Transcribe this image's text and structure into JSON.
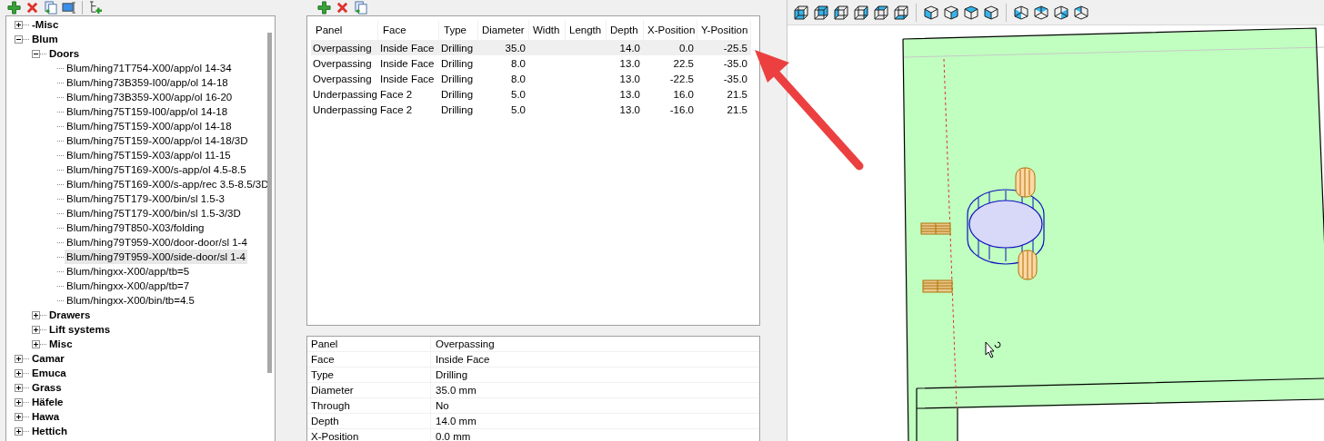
{
  "tree": [
    {
      "label": "-Misc",
      "kind": "folder",
      "expanded": false,
      "selected": false
    },
    {
      "label": "Blum",
      "kind": "folder",
      "expanded": true,
      "selected": false,
      "children": [
        {
          "label": "Doors",
          "kind": "folder",
          "expanded": true,
          "selected": false,
          "children": [
            {
              "label": "Blum/hing71T754-X00/app/ol 14-34",
              "kind": "item",
              "selected": false
            },
            {
              "label": "Blum/hing73B359-I00/app/ol 14-18",
              "kind": "item",
              "selected": false
            },
            {
              "label": "Blum/hing73B359-X00/app/ol 16-20",
              "kind": "item",
              "selected": false
            },
            {
              "label": "Blum/hing75T159-I00/app/ol 14-18",
              "kind": "item",
              "selected": false
            },
            {
              "label": "Blum/hing75T159-X00/app/ol 14-18",
              "kind": "item",
              "selected": false
            },
            {
              "label": "Blum/hing75T159-X00/app/ol 14-18/3D",
              "kind": "item",
              "selected": false
            },
            {
              "label": "Blum/hing75T159-X03/app/ol 11-15",
              "kind": "item",
              "selected": false
            },
            {
              "label": "Blum/hing75T169-X00/s-app/ol 4.5-8.5",
              "kind": "item",
              "selected": false
            },
            {
              "label": "Blum/hing75T169-X00/s-app/rec 3.5-8.5/3D",
              "kind": "item",
              "selected": false
            },
            {
              "label": "Blum/hing75T179-X00/bin/sl 1.5-3",
              "kind": "item",
              "selected": false
            },
            {
              "label": "Blum/hing75T179-X00/bin/sl 1.5-3/3D",
              "kind": "item",
              "selected": false
            },
            {
              "label": "Blum/hing79T850-X03/folding",
              "kind": "item",
              "selected": false
            },
            {
              "label": "Blum/hing79T959-X00/door-door/sl 1-4",
              "kind": "item",
              "selected": false
            },
            {
              "label": "Blum/hing79T959-X00/side-door/sl 1-4",
              "kind": "item",
              "selected": true
            },
            {
              "label": "Blum/hingxx-X00/app/tb=5",
              "kind": "item",
              "selected": false
            },
            {
              "label": "Blum/hingxx-X00/app/tb=7",
              "kind": "item",
              "selected": false
            },
            {
              "label": "Blum/hingxx-X00/bin/tb=4.5",
              "kind": "item",
              "selected": false
            }
          ]
        },
        {
          "label": "Drawers",
          "kind": "folder",
          "expanded": false,
          "selected": false
        },
        {
          "label": "Lift systems",
          "kind": "folder",
          "expanded": false,
          "selected": false
        },
        {
          "label": "Misc",
          "kind": "folder",
          "expanded": false,
          "selected": false
        }
      ]
    },
    {
      "label": "Camar",
      "kind": "folder",
      "expanded": false,
      "selected": false
    },
    {
      "label": "Emuca",
      "kind": "folder",
      "expanded": false,
      "selected": false
    },
    {
      "label": "Grass",
      "kind": "folder",
      "expanded": false,
      "selected": false
    },
    {
      "label": "Häfele",
      "kind": "folder",
      "expanded": false,
      "selected": false
    },
    {
      "label": "Hawa",
      "kind": "folder",
      "expanded": false,
      "selected": false
    },
    {
      "label": "Hettich",
      "kind": "folder",
      "expanded": false,
      "selected": false
    }
  ],
  "hole_table": {
    "columns": [
      "Panel",
      "Face",
      "Type",
      "Diameter",
      "Width",
      "Length",
      "Depth",
      "X-Position",
      "Y-Position"
    ],
    "rows": [
      {
        "cells": [
          "Overpassing",
          "Inside Face",
          "Drilling",
          "35.0",
          "",
          "",
          "14.0",
          "0.0",
          "-25.5"
        ],
        "selected": true
      },
      {
        "cells": [
          "Overpassing",
          "Inside Face",
          "Drilling",
          "8.0",
          "",
          "",
          "13.0",
          "22.5",
          "-35.0"
        ],
        "selected": false
      },
      {
        "cells": [
          "Overpassing",
          "Inside Face",
          "Drilling",
          "8.0",
          "",
          "",
          "13.0",
          "-22.5",
          "-35.0"
        ],
        "selected": false
      },
      {
        "cells": [
          "Underpassing",
          "Face 2",
          "Drilling",
          "5.0",
          "",
          "",
          "13.0",
          "16.0",
          "21.5"
        ],
        "selected": false
      },
      {
        "cells": [
          "Underpassing",
          "Face 2",
          "Drilling",
          "5.0",
          "",
          "",
          "13.0",
          "-16.0",
          "21.5"
        ],
        "selected": false
      }
    ]
  },
  "properties": [
    {
      "name": "Panel",
      "value": "Overpassing"
    },
    {
      "name": "Face",
      "value": "Inside Face"
    },
    {
      "name": "Type",
      "value": "Drilling"
    },
    {
      "name": "Diameter",
      "value": "35.0 mm"
    },
    {
      "name": "Through",
      "value": "No"
    },
    {
      "name": "Depth",
      "value": "14.0 mm"
    },
    {
      "name": "X-Position",
      "value": "0.0 mm"
    }
  ]
}
